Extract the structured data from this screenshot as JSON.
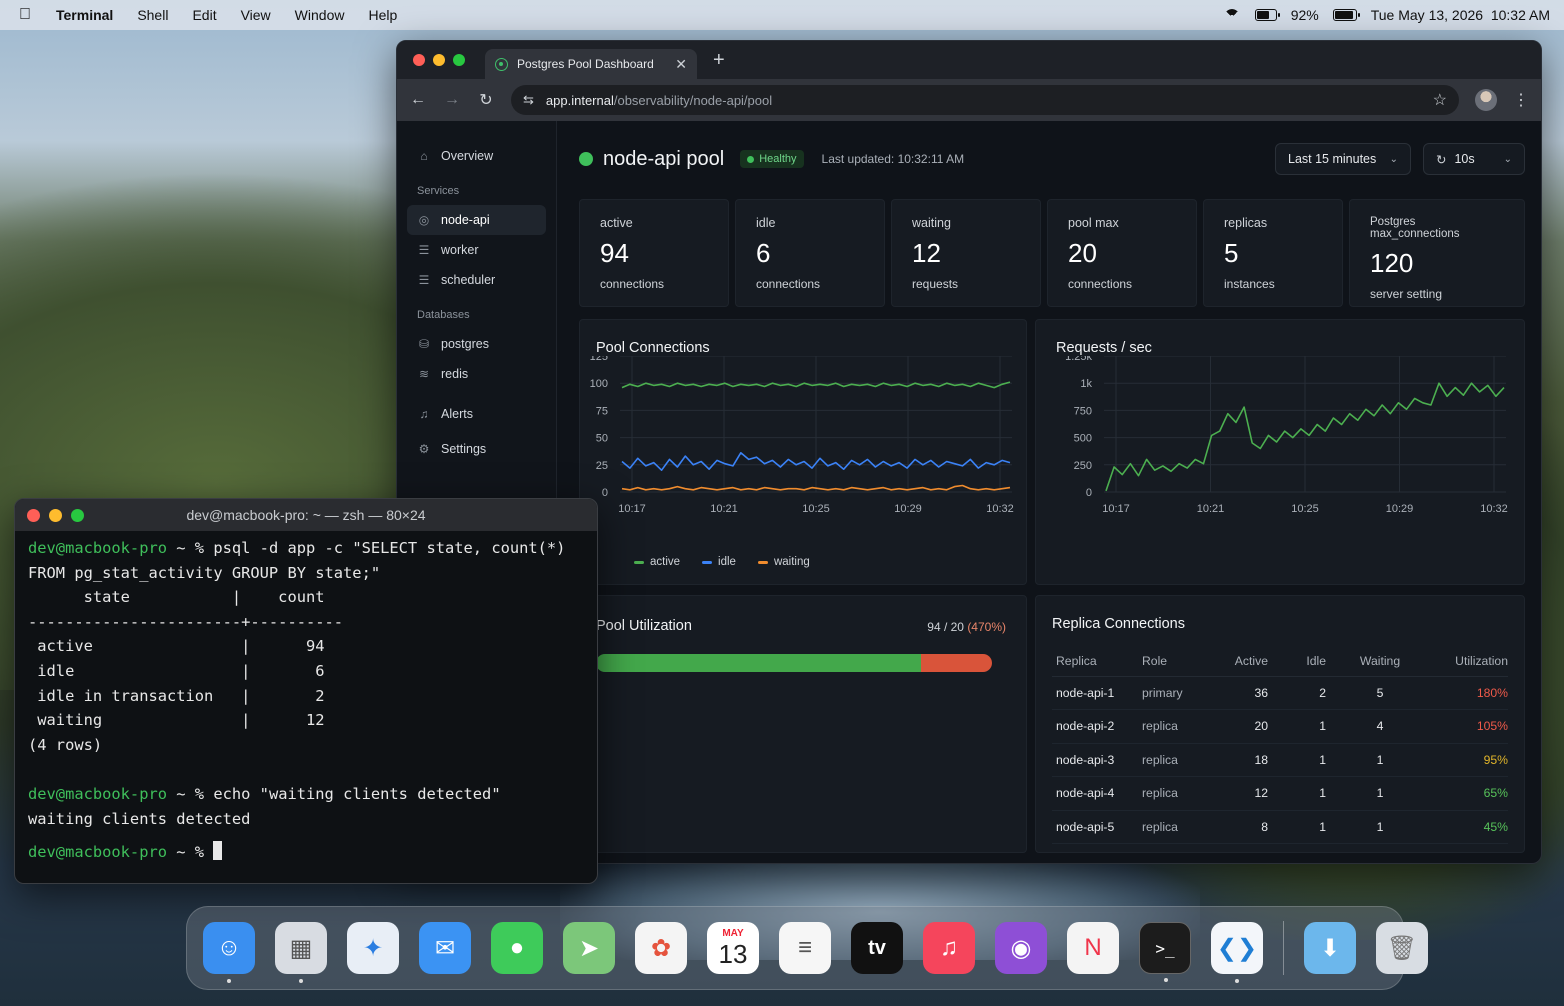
{
  "menubar": {
    "app": "Terminal",
    "items": [
      "Shell",
      "Edit",
      "View",
      "Window",
      "Help"
    ],
    "battery_pct": "92%",
    "datetime": "Tue May 13, 2026  10:32 AM"
  },
  "browser": {
    "tab_title": "Postgres Pool Dashboard",
    "url_host": "app.internal",
    "url_path": "/observability/node-api/pool"
  },
  "sidebar": {
    "overview": "Overview",
    "services_label": "Services",
    "services": [
      "node-api",
      "worker",
      "scheduler"
    ],
    "databases_label": "Databases",
    "databases": [
      "postgres",
      "redis"
    ],
    "alerts": "Alerts",
    "settings": "Settings"
  },
  "header": {
    "title": "node-api pool",
    "status": "Healthy",
    "updated": "Last updated: 10:32:11 AM",
    "range": "Last 15 minutes",
    "refresh": "10s"
  },
  "stats": [
    {
      "label": "active",
      "value": "94",
      "sub": "connections"
    },
    {
      "label": "idle",
      "value": "6",
      "sub": "connections"
    },
    {
      "label": "waiting",
      "value": "12",
      "sub": "requests"
    },
    {
      "label": "pool max",
      "value": "20",
      "sub": "connections"
    },
    {
      "label": "replicas",
      "value": "5",
      "sub": "instances"
    },
    {
      "label": "Postgres max_connections",
      "value": "120",
      "sub": "server setting"
    }
  ],
  "chart_data": [
    {
      "type": "line",
      "title": "Pool Connections",
      "x": [
        "10:17",
        "10:21",
        "10:25",
        "10:29",
        "10:32"
      ],
      "ylim": [
        0,
        125
      ],
      "yticks": [
        125,
        100,
        75,
        50,
        25,
        0
      ],
      "series": [
        {
          "name": "active",
          "color": "#4caf50",
          "values": [
            96,
            99,
            97,
            100,
            98,
            99,
            97,
            100,
            98,
            99,
            97,
            99,
            98,
            100,
            97,
            99,
            98,
            99,
            97,
            100,
            98,
            99,
            97,
            100,
            98,
            99,
            98,
            100,
            97,
            99,
            98,
            99,
            97,
            100,
            98,
            99,
            97,
            100,
            98,
            99,
            97,
            100,
            98,
            99,
            97,
            100,
            98,
            96,
            99,
            101
          ]
        },
        {
          "name": "idle",
          "color": "#3b82f6",
          "values": [
            28,
            22,
            31,
            24,
            27,
            20,
            30,
            23,
            33,
            25,
            28,
            21,
            29,
            26,
            24,
            36,
            30,
            32,
            26,
            29,
            23,
            30,
            25,
            28,
            22,
            31,
            24,
            27,
            21,
            29,
            25,
            30,
            23,
            28,
            24,
            27,
            22,
            30,
            25,
            29,
            23,
            28,
            26,
            24,
            30,
            22,
            27,
            25,
            29,
            27
          ]
        },
        {
          "name": "waiting",
          "color": "#f08c2e",
          "values": [
            3,
            2,
            4,
            2,
            3,
            2,
            3,
            5,
            3,
            2,
            4,
            3,
            2,
            3,
            4,
            2,
            3,
            2,
            4,
            3,
            2,
            3,
            3,
            2,
            4,
            3,
            2,
            3,
            2,
            4,
            3,
            2,
            3,
            4,
            2,
            3,
            2,
            3,
            4,
            2,
            3,
            2,
            5,
            6,
            3,
            2,
            3,
            2,
            3,
            4
          ]
        }
      ],
      "legend": "bottom"
    },
    {
      "type": "line",
      "title": "Requests / sec",
      "x": [
        "10:17",
        "10:21",
        "10:25",
        "10:29",
        "10:32"
      ],
      "ylim": [
        0,
        1250
      ],
      "yticks": [
        "1.25k",
        "1k",
        "750",
        "500",
        "250",
        "0"
      ],
      "series": [
        {
          "name": "",
          "color": "#4caf50",
          "values": [
            10,
            230,
            160,
            260,
            150,
            300,
            200,
            240,
            190,
            260,
            220,
            300,
            260,
            520,
            560,
            720,
            640,
            780,
            450,
            400,
            520,
            460,
            560,
            500,
            580,
            520,
            620,
            560,
            680,
            620,
            720,
            660,
            760,
            700,
            800,
            720,
            820,
            760,
            860,
            820,
            800,
            1000,
            880,
            960,
            890,
            1000,
            920,
            980,
            880,
            960
          ]
        }
      ]
    }
  ],
  "utilization": {
    "title": "Pool Utilization",
    "value": "94 / 20",
    "pct": "(470%)",
    "fill_fraction": 0.82
  },
  "replicas": {
    "title": "Replica Connections",
    "headers": [
      "Replica",
      "Role",
      "Active",
      "Idle",
      "Waiting",
      "Utilization"
    ],
    "rows": [
      {
        "name": "node-api-1",
        "role": "primary",
        "active": "36",
        "idle": "2",
        "waiting": "5",
        "util": "180%",
        "color": "#ef5a4a"
      },
      {
        "name": "node-api-2",
        "role": "replica",
        "active": "20",
        "idle": "1",
        "waiting": "4",
        "util": "105%",
        "color": "#ef5a4a"
      },
      {
        "name": "node-api-3",
        "role": "replica",
        "active": "18",
        "idle": "1",
        "waiting": "1",
        "util": "95%",
        "color": "#e0b42a"
      },
      {
        "name": "node-api-4",
        "role": "replica",
        "active": "12",
        "idle": "1",
        "waiting": "1",
        "util": "65%",
        "color": "#57c25a"
      },
      {
        "name": "node-api-5",
        "role": "replica",
        "active": "8",
        "idle": "1",
        "waiting": "1",
        "util": "45%",
        "color": "#57c25a"
      }
    ]
  },
  "terminal": {
    "title": "dev@macbook-pro: ~ — zsh — 80×24",
    "prompt": "dev@macbook-pro ~ % ",
    "lines": [
      {
        "prompt": true,
        "text": "psql -d app -c \"SELECT state, count(*)"
      },
      {
        "prompt": false,
        "text": "FROM pg_stat_activity GROUP BY state;\""
      },
      {
        "prompt": false,
        "text": "      state           |    count"
      },
      {
        "prompt": false,
        "text": "-----------------------+----------"
      },
      {
        "prompt": false,
        "text": " active                |      94"
      },
      {
        "prompt": false,
        "text": " idle                  |       6"
      },
      {
        "prompt": false,
        "text": " idle in transaction   |       2"
      },
      {
        "prompt": false,
        "text": " waiting               |      12"
      },
      {
        "prompt": false,
        "text": "(4 rows)"
      },
      {
        "prompt": false,
        "text": ""
      },
      {
        "prompt": true,
        "text": "echo \"waiting clients detected\""
      },
      {
        "prompt": false,
        "text": "waiting clients detected"
      },
      {
        "prompt": true,
        "text": "",
        "cursor": true
      }
    ]
  },
  "dock": {
    "calendar_month": "MAY",
    "calendar_day": "13",
    "tv_label": "tv",
    "apps": [
      {
        "icon": "finder-icon",
        "bg": "#3a8ff0",
        "running": true
      },
      {
        "icon": "launchpad-icon",
        "bg": "#d8dce2",
        "running": true
      },
      {
        "icon": "safari-icon",
        "bg": "#e8eef6",
        "running": false
      },
      {
        "icon": "mail-icon",
        "bg": "#3b93f3",
        "running": false
      },
      {
        "icon": "messages-icon",
        "bg": "#3ecb5a",
        "running": false
      },
      {
        "icon": "maps-icon",
        "bg": "#7cc77a",
        "running": false
      },
      {
        "icon": "photos-icon",
        "bg": "#f4f4f4",
        "running": false
      },
      {
        "icon": "calendar-icon",
        "bg": "#ffffff",
        "running": false
      },
      {
        "icon": "reminders-icon",
        "bg": "#f6f6f6",
        "running": false
      },
      {
        "icon": "apple-tv-icon",
        "bg": "#111111",
        "running": false
      },
      {
        "icon": "music-icon",
        "bg": "#f5455c",
        "running": false
      },
      {
        "icon": "podcasts-icon",
        "bg": "#8e4fd6",
        "running": false
      },
      {
        "icon": "news-icon",
        "bg": "#f4f4f4",
        "running": false
      },
      {
        "icon": "terminal-icon",
        "bg": "#1c1c1c",
        "running": true
      },
      {
        "icon": "vscode-icon",
        "bg": "#f3f6fa",
        "running": true
      },
      {
        "icon": "downloads-folder-icon",
        "bg": "#6cb7ec",
        "running": false
      },
      {
        "icon": "trash-icon",
        "bg": "#d8dde3",
        "running": false
      }
    ]
  }
}
